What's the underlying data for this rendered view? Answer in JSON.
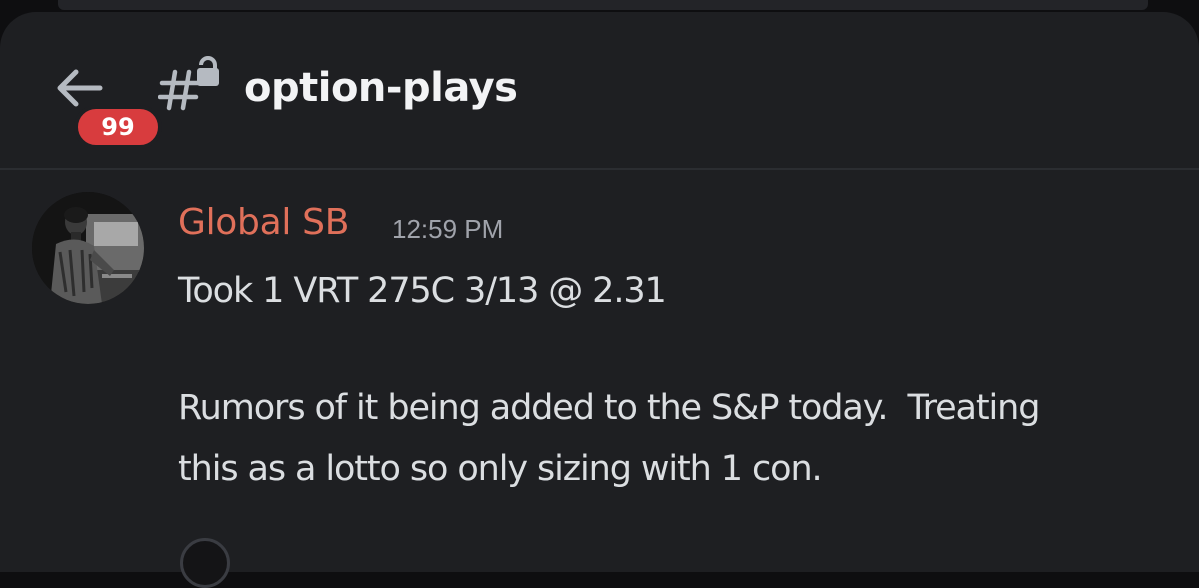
{
  "header": {
    "back_label": "Back",
    "unread_badge": "99",
    "channel_name": "option-plays"
  },
  "message": {
    "author": "Global SB",
    "timestamp": "12:59 PM",
    "lines": [
      "Took 1 VRT 275C 3/13 @ 2.31",
      "Rumors of it being added to the S&P today.  Treating",
      "this as a lotto so only sizing with 1 con."
    ]
  },
  "colors": {
    "background": "#1e1f22",
    "author": "#e0705a",
    "badge": "#d83c3e",
    "text": "#dbdee1",
    "muted": "#a0a3ab"
  }
}
